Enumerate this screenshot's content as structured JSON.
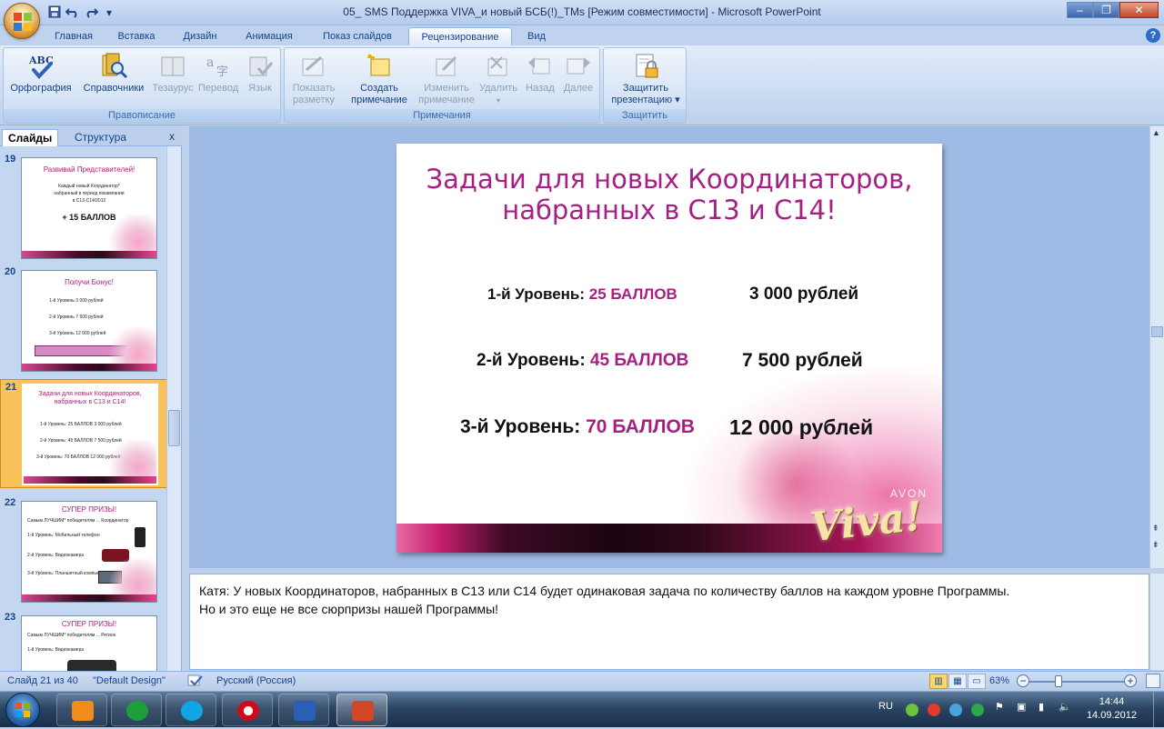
{
  "window": {
    "title": "05_ SMS Поддержка VIVA_и новый БСБ(!)_TMs [Режим совместимости] - Microsoft PowerPoint"
  },
  "qat": {
    "save": "save-icon",
    "undo": "undo-icon",
    "redo": "redo-icon",
    "more": "▾"
  },
  "tabs": [
    "Главная",
    "Вставка",
    "Дизайн",
    "Анимация",
    "Показ слайдов",
    "Рецензирование",
    "Вид"
  ],
  "active_tab": "Рецензирование",
  "ribbon": {
    "proofing": {
      "label": "Правописание",
      "spelling": "Орфография",
      "research": "Справочники",
      "thesaurus": "Тезаурус",
      "translate": "Перевод",
      "language": "Язык"
    },
    "comments": {
      "label": "Примечания",
      "show_markup_1": "Показать",
      "show_markup_2": "разметку",
      "new_comment_1": "Создать",
      "new_comment_2": "примечание",
      "edit_comment_1": "Изменить",
      "edit_comment_2": "примечание",
      "delete": "Удалить",
      "previous": "Назад",
      "next": "Далее"
    },
    "protect": {
      "label": "Защитить",
      "protect_1": "Защитить",
      "protect_2": "презентацию ▾"
    }
  },
  "sidebar": {
    "tab_slides": "Слайды",
    "tab_outline": "Структура",
    "close": "x",
    "thumbs": [
      {
        "num": "19",
        "title": "Развивай Представителей!",
        "lines": [
          "Каждый новый Координатор*",
          "набранный в период покампании",
          "в С13-С14/2012"
        ],
        "big": "+ 15 БАЛЛОВ"
      },
      {
        "num": "20",
        "title": "Получи Бонус!",
        "lines": [
          "1-й Уровень   3 000 рублей",
          "2-й Уровень   7 500 рублей",
          "3-й Уровень   12 000 рублей"
        ],
        "big": ""
      },
      {
        "num": "21",
        "title": "Задачи для новых Координаторов, набранных в С13 и С14!",
        "lines": [
          "1-й Уровень: 25 БАЛЛОВ   3 000 рублей",
          "2-й Уровень: 45 БАЛЛОВ   7 500 рублей",
          "3-й Уровень: 70 БАЛЛОВ   12 000 рублей"
        ],
        "big": ""
      },
      {
        "num": "22",
        "title": "СУПЕР ПРИЗЫ!",
        "lines": [
          "Самым ЛУЧШИМ* победителям ... Координатор",
          "1-й Уровень: Мобильный телефон",
          "2-й Уровень: Видеокамера",
          "3-й Уровень: Планшетный компьютер"
        ],
        "big": ""
      },
      {
        "num": "23",
        "title": "СУПЕР ПРИЗЫ!",
        "lines": [
          "Самым ЛУЧШИМ* победителям ... Регион",
          "1-й Уровень: Видеокамера"
        ],
        "big": ""
      }
    ]
  },
  "slide": {
    "title": "Задачи для новых Координаторов, набранных в С13 и С14!",
    "levels": [
      {
        "label": "1-й Уровень:",
        "points": "25 БАЛЛОВ",
        "reward": "3 000 рублей"
      },
      {
        "label": "2-й Уровень:",
        "points": "45 БАЛЛОВ",
        "reward": "7 500 рублей"
      },
      {
        "label": "3-й Уровень:",
        "points": "70  БАЛЛОВ",
        "reward": "12 000 рублей"
      }
    ],
    "brand": "AVON",
    "logo": "Viva!"
  },
  "notes": {
    "line1": "Катя: У новых Координаторов, набранных в С13 или С14 будет одинаковая задача по количеству баллов на каждом уровне Программы.",
    "line2": "Но и это еще не все сюрпризы нашей Программы!"
  },
  "status": {
    "slide_count": "Слайд 21 из 40",
    "design": "\"Default Design\"",
    "language": "Русский (Россия)",
    "zoom": "63%"
  },
  "taskbar": {
    "lang": "RU",
    "time": "14:44",
    "date": "14.09.2012"
  },
  "colors": {
    "accent": "#a61f82",
    "ribbon": "#c7d9f1",
    "selected_thumb": "#f9c25a"
  }
}
